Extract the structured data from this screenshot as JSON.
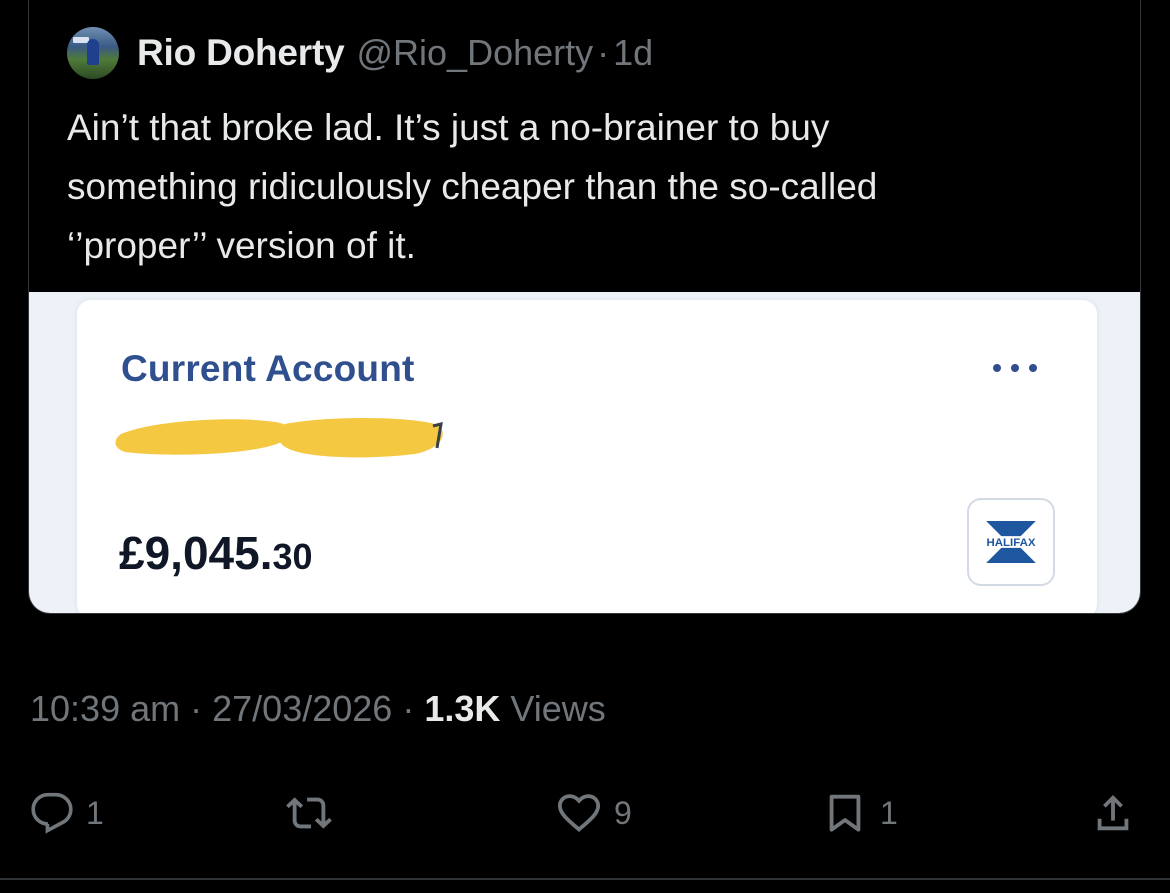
{
  "quoted_tweet": {
    "author_name": "Rio Doherty",
    "handle": "@Rio_Doherty",
    "separator": "·",
    "age": "1d",
    "text": "Ain’t that broke lad. It’s just a no-brainer to buy\nsomething ridiculously cheaper than the so-called\n‘’proper’’ version of it.",
    "avatar_icon": "avatar-photo",
    "media": {
      "account_title": "Current Account",
      "more_icon": "more-dots-icon",
      "redaction_color": "#f5c842",
      "balance_main": "£9,045.",
      "balance_pence": "30",
      "bank_logo_text": "HALIFAX",
      "bank_logo_color": "#1e56a0"
    }
  },
  "tweet_meta": {
    "time": "10:39 am",
    "sep1": "·",
    "date": "27/03/2026",
    "sep2": "·",
    "views_count": "1.3K",
    "views_label": "Views"
  },
  "actions": {
    "replies": "1",
    "likes": "9",
    "bookmarks": "1"
  },
  "colors": {
    "background": "#000000",
    "primary_text": "#e7e9ea",
    "secondary_text": "#71767b",
    "account_title": "#2f4f8e"
  }
}
